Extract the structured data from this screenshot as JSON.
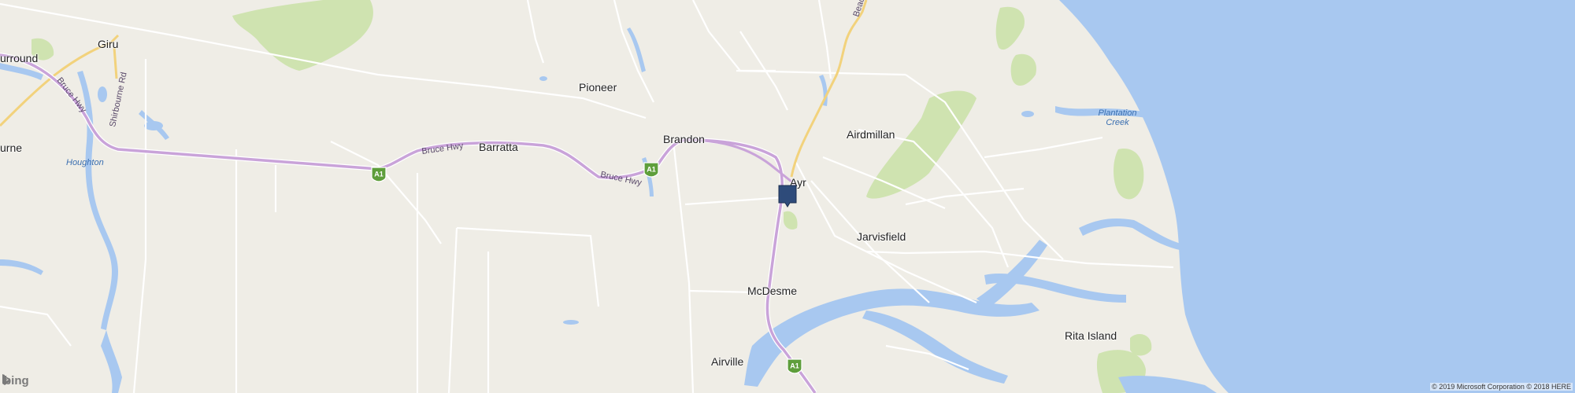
{
  "map": {
    "places": [
      {
        "name": "urround"
      },
      {
        "name": "Giru"
      },
      {
        "name": "urne"
      },
      {
        "name": "Pioneer"
      },
      {
        "name": "Brandon"
      },
      {
        "name": "Barratta"
      },
      {
        "name": "Airdmillan"
      },
      {
        "name": "Ayr"
      },
      {
        "name": "Jarvisfield"
      },
      {
        "name": "McDesme"
      },
      {
        "name": "Rita Island"
      },
      {
        "name": "Airville"
      }
    ],
    "water_labels": [
      {
        "name": "Houghton"
      },
      {
        "name": "Plantation Creek"
      }
    ],
    "road_labels": [
      {
        "name": "Bruce Hwy"
      },
      {
        "name": "Shirbourne Rd"
      },
      {
        "name": "Bruce Hwy"
      },
      {
        "name": "Bruce Hwy"
      },
      {
        "name": "Beach Rd"
      }
    ],
    "highway_shields": [
      {
        "label": "A1"
      },
      {
        "label": "A1"
      },
      {
        "label": "A1"
      }
    ],
    "marker": {
      "icon": "location-pin-icon",
      "color": "#2e4b7a"
    },
    "colors": {
      "land": "#efede6",
      "water": "#a8c8f0",
      "park": "#cfe3b0",
      "highway": "#c9a3d9",
      "road": "#ffffff",
      "major_road": "#f2d27c"
    }
  },
  "branding": {
    "logo": "bing"
  },
  "copyright": "© 2019 Microsoft Corporation © 2018 HERE"
}
